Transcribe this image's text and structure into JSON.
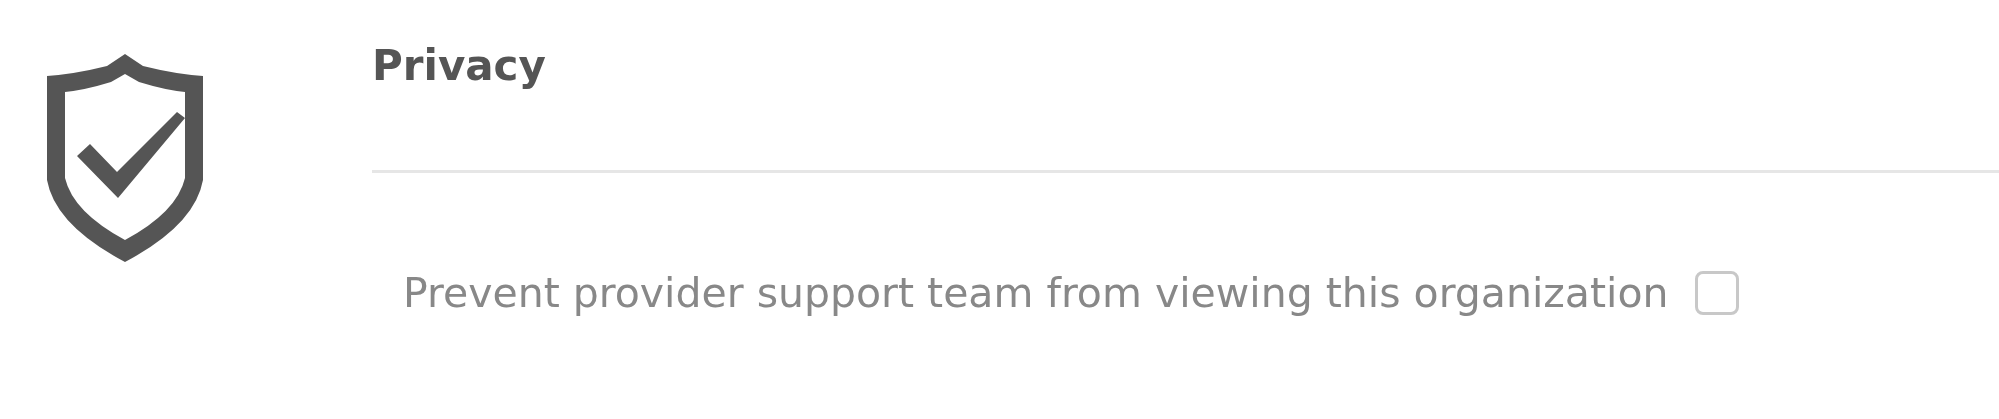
{
  "section": {
    "title": "Privacy"
  },
  "options": [
    {
      "label": "Prevent provider support team from viewing this organization",
      "checked": false
    }
  ]
}
